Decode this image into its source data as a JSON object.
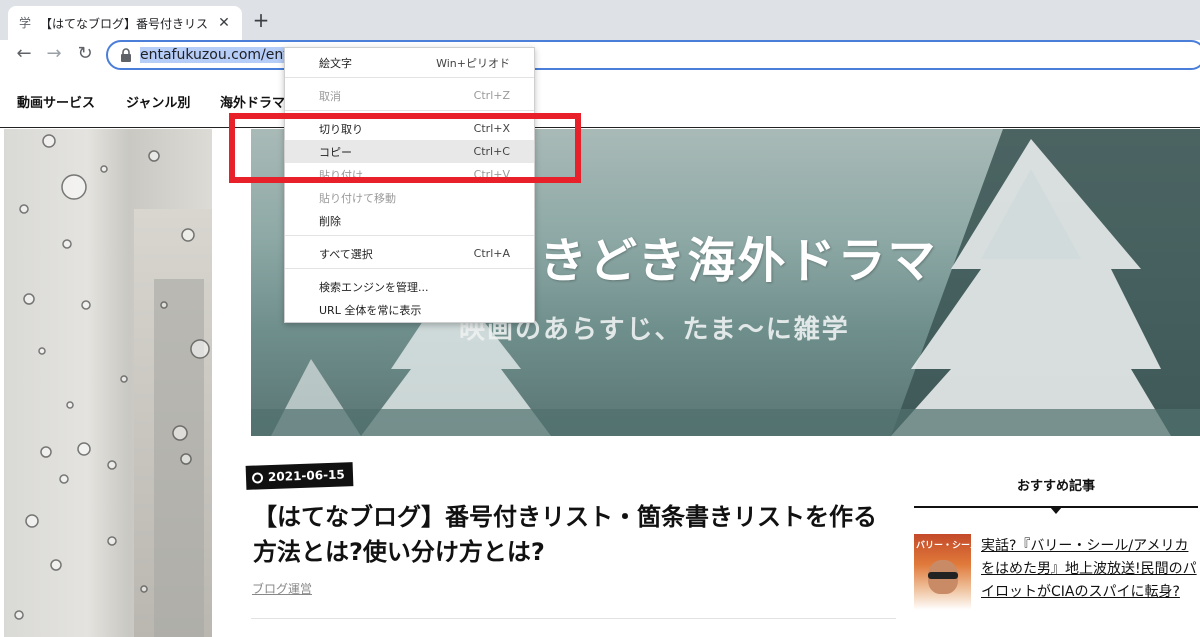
{
  "browser": {
    "tab_title": "【はてなブログ】番号付きリスト・箇条書き",
    "tab_favicon": "学",
    "tab_close": "✕",
    "new_tab": "+",
    "back": "←",
    "forward": "→",
    "reload": "↻",
    "url_visible": "entafukuzou.com/entry/"
  },
  "site_nav": {
    "items": [
      "動画サービス",
      "ジャンル別",
      "海外ドラマ"
    ]
  },
  "banner": {
    "title": "きどき海外ドラマ",
    "subtitle": "映画のあらすじ、たま～に雑学"
  },
  "article": {
    "date": "2021-06-15",
    "title": "【はてなブログ】番号付きリスト・箇条書きリストを作る方法とは?使い分け方とは?",
    "category": "ブログ運営"
  },
  "sidebar": {
    "heading": "おすすめ記事",
    "thumb_text": "バリー・シール",
    "link": "実話?『バリー・シール/アメリカをはめた男』地上波放送!民間のパイロットがCIAのスパイに転身?"
  },
  "context_menu": {
    "items": [
      {
        "label": "絵文字",
        "shortcut": "Win+ピリオド"
      },
      {
        "label": "取消",
        "shortcut": "Ctrl+Z"
      },
      {
        "label": "切り取り",
        "shortcut": "Ctrl+X"
      },
      {
        "label": "コピー",
        "shortcut": "Ctrl+C"
      },
      {
        "label": "貼り付け",
        "shortcut": "Ctrl+V"
      },
      {
        "label": "貼り付けて移動",
        "shortcut": ""
      },
      {
        "label": "削除",
        "shortcut": ""
      },
      {
        "label": "すべて選択",
        "shortcut": "Ctrl+A"
      },
      {
        "label": "検索エンジンを管理...",
        "shortcut": ""
      },
      {
        "label": "URL 全体を常に表示",
        "shortcut": ""
      }
    ]
  },
  "colors": {
    "annotation": "#e8202a",
    "omnibox_focus": "#4a7ed9",
    "selection": "#b5cdf7"
  }
}
